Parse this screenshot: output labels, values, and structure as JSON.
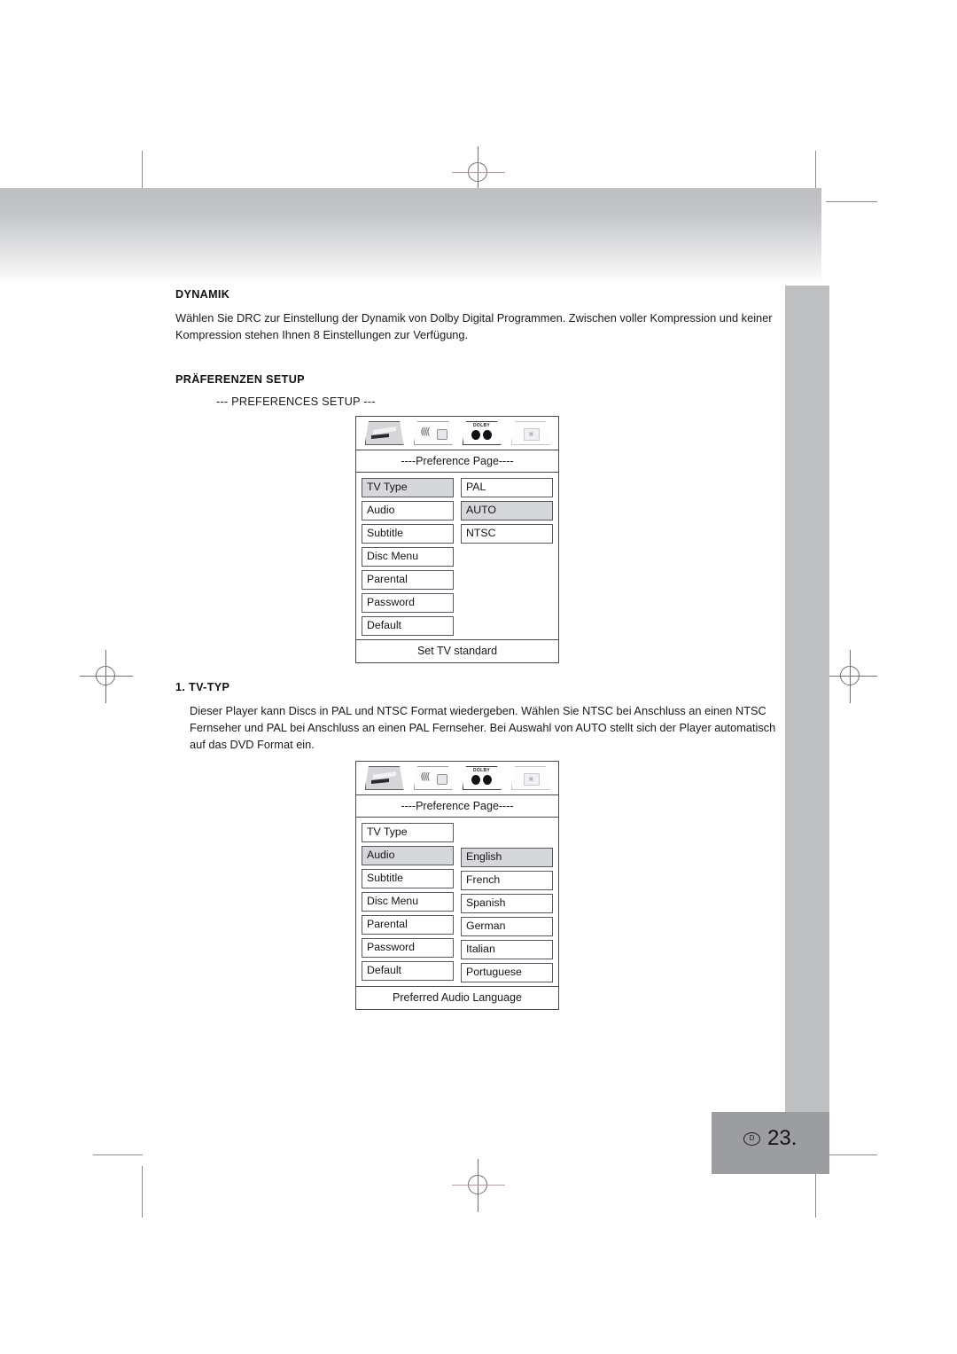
{
  "page": {
    "number": "23.",
    "language_badge": "D"
  },
  "sections": [
    {
      "heading": "DYNAMIK",
      "paragraphs": [
        "Wählen Sie DRC zur Einstellung der Dynamik von Dolby Digital Programmen. Zwischen voller Kompression und keiner Kompression stehen Ihnen 8 Einstellungen zur Verfügung."
      ]
    },
    {
      "heading": "PRÄFERENZEN SETUP",
      "sub_label": "--- PREFERENCES SETUP ---"
    },
    {
      "heading": "1. TV-TYP",
      "paragraphs": [
        "Dieser Player kann Discs in PAL und NTSC Format wiedergeben. Wählen Sie NTSC bei Anschluss an einen NTSC Fernseher und PAL bei Anschluss an einen PAL Fernseher. Bei Auswahl von AUTO stellt sich der Player automatisch auf das DVD Format ein."
      ]
    }
  ],
  "osd_menus": [
    {
      "id": "preference-tv-type",
      "icons": [
        {
          "name": "general-setup-icon",
          "label": ""
        },
        {
          "name": "audio-setup-icon",
          "label": ""
        },
        {
          "name": "dolby-setup-icon",
          "label": "DOLBY"
        },
        {
          "name": "preferences-setup-icon",
          "label": ""
        }
      ],
      "title": "----Preference Page----",
      "left_items": [
        {
          "label": "TV Type",
          "selected": true
        },
        {
          "label": "Audio",
          "selected": false
        },
        {
          "label": "Subtitle",
          "selected": false
        },
        {
          "label": "Disc Menu",
          "selected": false
        },
        {
          "label": "Parental",
          "selected": false
        },
        {
          "label": "Password",
          "selected": false
        },
        {
          "label": "Default",
          "selected": false
        }
      ],
      "right_items": [
        {
          "label": "PAL",
          "selected": false
        },
        {
          "label": "AUTO",
          "selected": true
        },
        {
          "label": "NTSC",
          "selected": false
        }
      ],
      "right_offset": false,
      "footer": "Set TV standard"
    },
    {
      "id": "preference-audio-language",
      "icons": [
        {
          "name": "general-setup-icon",
          "label": ""
        },
        {
          "name": "audio-setup-icon",
          "label": ""
        },
        {
          "name": "dolby-setup-icon",
          "label": "DOLBY"
        },
        {
          "name": "preferences-setup-icon",
          "label": ""
        }
      ],
      "title": "----Preference Page----",
      "left_items": [
        {
          "label": "TV Type",
          "selected": false
        },
        {
          "label": "Audio",
          "selected": true
        },
        {
          "label": "Subtitle",
          "selected": false
        },
        {
          "label": "Disc Menu",
          "selected": false
        },
        {
          "label": "Parental",
          "selected": false
        },
        {
          "label": "Password",
          "selected": false
        },
        {
          "label": "Default",
          "selected": false
        }
      ],
      "right_items": [
        {
          "label": "English",
          "selected": true
        },
        {
          "label": "French",
          "selected": false
        },
        {
          "label": "Spanish",
          "selected": false
        },
        {
          "label": "German",
          "selected": false
        },
        {
          "label": "Italian",
          "selected": false
        },
        {
          "label": "Portuguese",
          "selected": false
        }
      ],
      "right_offset": true,
      "footer": "Preferred Audio Language"
    }
  ],
  "colors": {
    "band_top": "#bcbec0",
    "side_bar": "#bdbfc1",
    "page_block": "#9b9da0",
    "selection": "#d6d7da",
    "menu_border": "#4a4a52"
  }
}
